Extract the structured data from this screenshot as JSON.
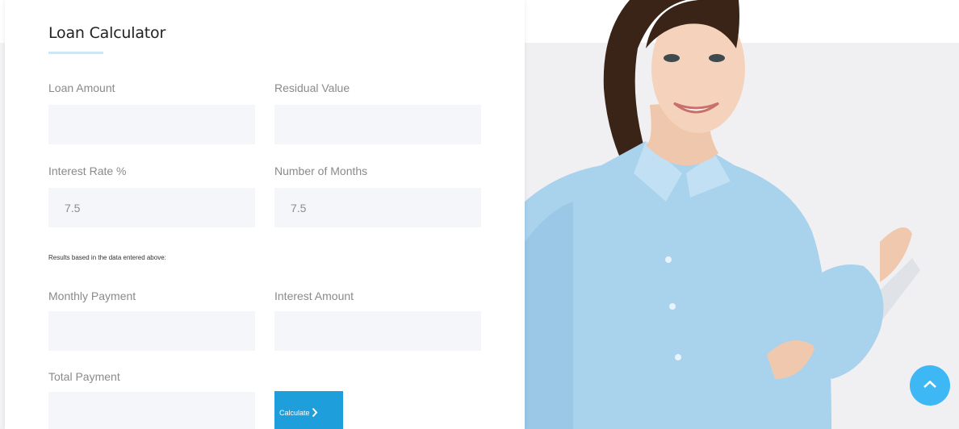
{
  "calculator": {
    "title": "Loan Calculator",
    "fields": {
      "loan_amount": {
        "label": "Loan Amount",
        "value": ""
      },
      "residual_value": {
        "label": "Residual Value",
        "value": ""
      },
      "interest_rate": {
        "label": "Interest Rate %",
        "value": "7.5"
      },
      "number_of_months": {
        "label": "Number of Months",
        "value": "7.5"
      }
    },
    "results_note": "Results based in the data entered above:",
    "results": {
      "monthly_payment": {
        "label": "Monthly Payment",
        "value": ""
      },
      "interest_amount": {
        "label": "Interest Amount",
        "value": ""
      },
      "total_payment": {
        "label": "Total Payment",
        "value": ""
      }
    },
    "calculate_button": {
      "label": "Calculate",
      "icon": "chevron-right-icon"
    }
  },
  "scroll_top": {
    "icon": "chevron-up-icon"
  },
  "colors": {
    "accent": "#1e9fdc",
    "scroll_button": "#3db8f5",
    "input_background": "#f4f6f9",
    "title_underline": "#cfe6f7",
    "label_text": "#8a8a8a"
  }
}
